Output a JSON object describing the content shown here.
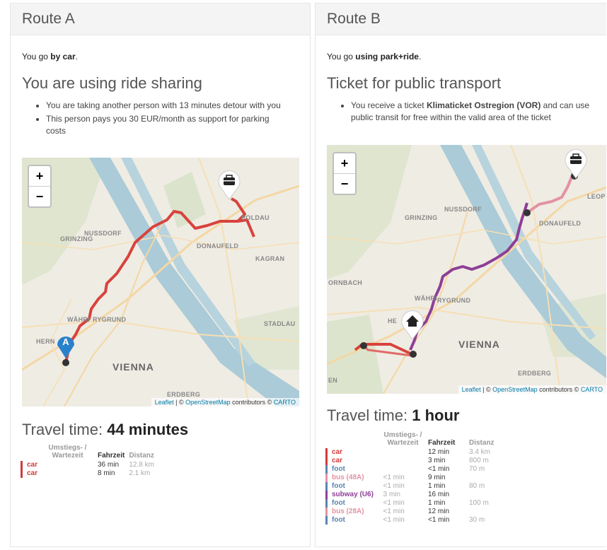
{
  "routeA": {
    "title": "Route A",
    "mode_prefix": "You go ",
    "mode_bold": "by car",
    "mode_suffix": ".",
    "section_title": "You are using ride sharing",
    "bullets": [
      "You are taking another person with 13 minutes detour with you",
      "This person pays you 30 EUR/month as support for parking costs"
    ],
    "map": {
      "zoom_in": "+",
      "zoom_out": "−",
      "places": [
        "NUSSDORF",
        "GRINZING",
        "DONAUFELD",
        "KAGRAN",
        "POLDAU",
        "WÄHRI",
        "RYGRUND",
        "STADLAU",
        "HERN",
        "ERDBERG"
      ],
      "city": "VIENNA",
      "marker_letter": "A",
      "attribution": {
        "leaflet": "Leaflet",
        "sep": " | © ",
        "osm": "OpenStreetMap",
        "contrib": " contributors © ",
        "carto": "CARTO"
      }
    },
    "travel_label": "Travel time: ",
    "travel_value": "44 minutes",
    "table": {
      "headers": [
        "Umstiegs- / Wartezeit",
        "Fahrzeit",
        "Distanz"
      ],
      "rows": [
        {
          "mode": "car",
          "wait": "",
          "time": "36 min",
          "dist": "12.8 km",
          "color": "#d03b3b"
        },
        {
          "mode": "car",
          "wait": "",
          "time": "8 min",
          "dist": "2.1 km",
          "color": "#d03b3b"
        }
      ]
    }
  },
  "routeB": {
    "title": "Route B",
    "mode_prefix": "You go ",
    "mode_bold": "using park+ride",
    "mode_suffix": ".",
    "section_title": "Ticket for public transport",
    "bullet_prefix": "You receive a ticket ",
    "bullet_bold": "Klimaticket Ostregion (VOR)",
    "bullet_suffix": " and can use public transit for free within the valid area of the ticket",
    "map": {
      "zoom_in": "+",
      "zoom_out": "−",
      "places": [
        "NUSSDORF",
        "GRINZING",
        "DONAUFELD",
        "LEOP",
        "ORNBACH",
        "WÄHRI",
        "RYGRUND",
        "HE",
        "EN",
        "ERDBERG"
      ],
      "city": "VIENNA",
      "attribution": {
        "leaflet": "Leaflet",
        "sep": " | © ",
        "osm": "OpenStreetMap",
        "contrib": " contributors © ",
        "carto": "CARTO"
      }
    },
    "travel_label": "Travel time: ",
    "travel_value": "1 hour",
    "table": {
      "headers": [
        "Umstiegs- / Wartezeit",
        "Fahrzeit",
        "Distanz"
      ],
      "rows": [
        {
          "mode": "car",
          "wait": "",
          "time": "12 min",
          "dist": "3.4 km",
          "color": "#d03b3b"
        },
        {
          "mode": "car",
          "wait": "",
          "time": "3 min",
          "dist": "800 m",
          "color": "#d03b3b"
        },
        {
          "mode": "foot",
          "wait": "",
          "time": "<1 min",
          "dist": "70 m",
          "color": "#5b84b1"
        },
        {
          "mode": "bus (48A)",
          "wait": "<1 min",
          "time": "9 min",
          "dist": "",
          "color": "#e392a3"
        },
        {
          "mode": "foot",
          "wait": "<1 min",
          "time": "1 min",
          "dist": "80 m",
          "color": "#5b84b1"
        },
        {
          "mode": "subway (U6)",
          "wait": "3 min",
          "time": "16 min",
          "dist": "",
          "color": "#8e3f96"
        },
        {
          "mode": "foot",
          "wait": "<1 min",
          "time": "1 min",
          "dist": "100 m",
          "color": "#5b84b1"
        },
        {
          "mode": "bus (28A)",
          "wait": "<1 min",
          "time": "12 min",
          "dist": "",
          "color": "#e392a3"
        },
        {
          "mode": "foot",
          "wait": "<1 min",
          "time": "<1 min",
          "dist": "30 m",
          "color": "#5b84b1"
        }
      ]
    }
  },
  "colors": {
    "car": "#d03b3b",
    "foot": "#5b84b1",
    "bus": "#e392a3",
    "subway": "#8e3f96",
    "marker_blue": "#2a81cb"
  },
  "icons": [
    "briefcase-icon",
    "home-icon",
    "location-pin-icon"
  ]
}
